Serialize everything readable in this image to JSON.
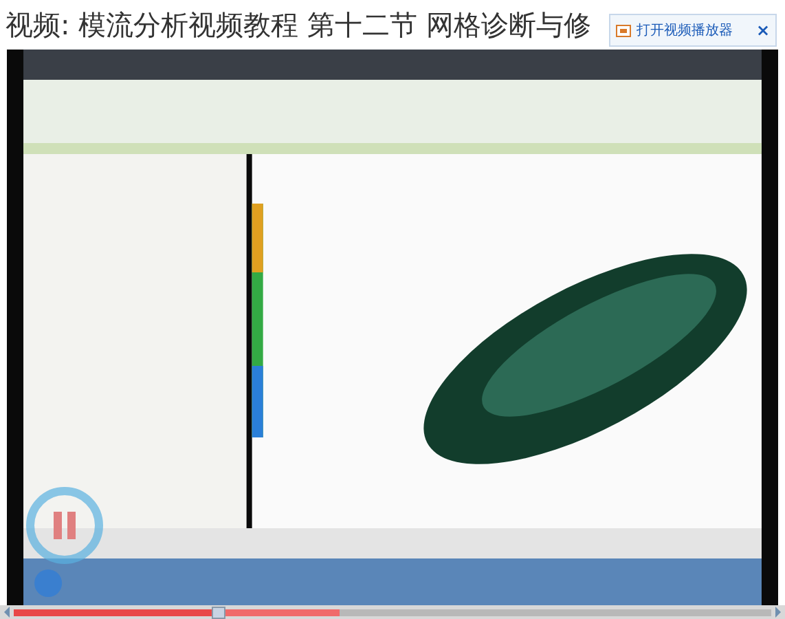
{
  "page_title": "视频: 模流分析视频教程 第十二节 网格诊断与修",
  "open_player": {
    "label": "打开视频播放器",
    "close": "×"
  },
  "video": {
    "kind": "picture",
    "paused": true
  },
  "progress": {
    "level": 0.27
  },
  "buffer": {
    "level": 0.43
  }
}
